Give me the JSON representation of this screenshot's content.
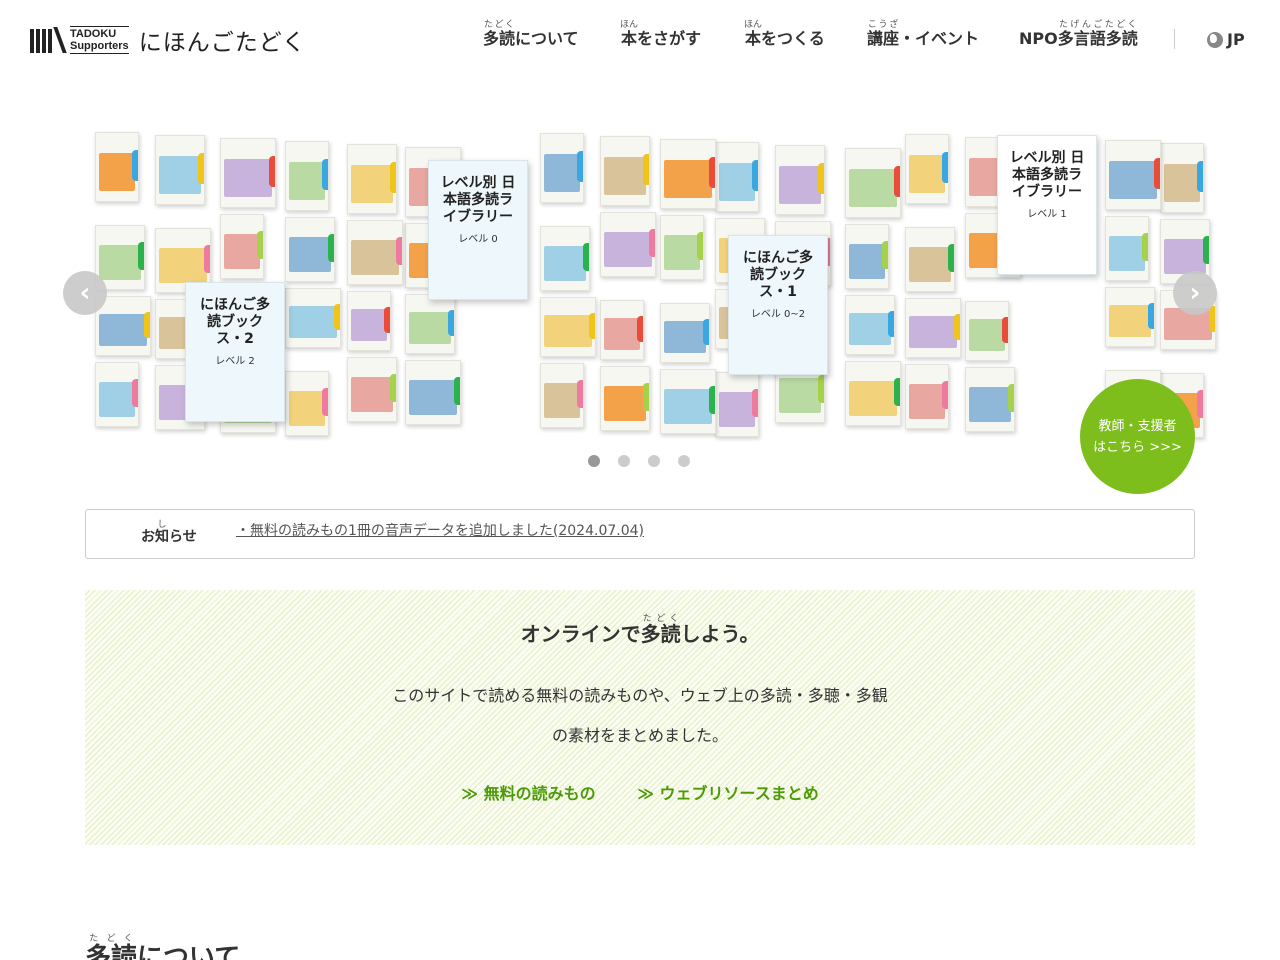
{
  "header": {
    "logo_line1": "TADOKU",
    "logo_line2": "Supporters",
    "site_name": "にほんごたどく",
    "nav": [
      {
        "pre": "",
        "base": "多読",
        "ruby": "たどく",
        "post": "について"
      },
      {
        "pre": "",
        "base": "本",
        "ruby": "ほん",
        "post": "をさがす"
      },
      {
        "pre": "",
        "base": "本",
        "ruby": "ほん",
        "post": "をつくる"
      },
      {
        "pre": "",
        "base": "講座",
        "ruby": "こうざ",
        "post": "・イベント"
      },
      {
        "pre": "NPO",
        "base": "多言語多読",
        "ruby": "たげんごたどく",
        "post": ""
      }
    ],
    "lang": "JP"
  },
  "hero": {
    "book_titles": [
      "レベル別 日本語多読ライブラリー",
      "にほんご多読ブックス・2",
      "にほんご多読ブックス・1",
      "レベル別 日本語多読ライブラリー"
    ],
    "book_subs": [
      "レベル 0",
      "レベル 2",
      "レベル 0~2",
      "レベル 1"
    ],
    "prev_label": "‹",
    "next_label": "›",
    "teacher_line1": "教師・支援者",
    "teacher_line2": "はこちら >>>"
  },
  "news": {
    "label": "お知らせ",
    "label_ruby": "し",
    "bullet": "・",
    "item_text": "無料の読みもの1冊の音声データを追加しました(2024.07.04)"
  },
  "online": {
    "title_pre": "オンラインで",
    "title_base": "多読",
    "title_ruby": "たどく",
    "title_post": "しよう。",
    "line1": "このサイトで読める無料の読みものや、ウェブ上の多読・多聴・多観",
    "line2": "の素材をまとめました。",
    "link1": "≫ 無料の読みもの",
    "link2": "≫ ウェブリソースまとめ"
  },
  "section": {
    "heading_base": "多読",
    "heading_ruby": "たどく",
    "heading_post": "について"
  }
}
